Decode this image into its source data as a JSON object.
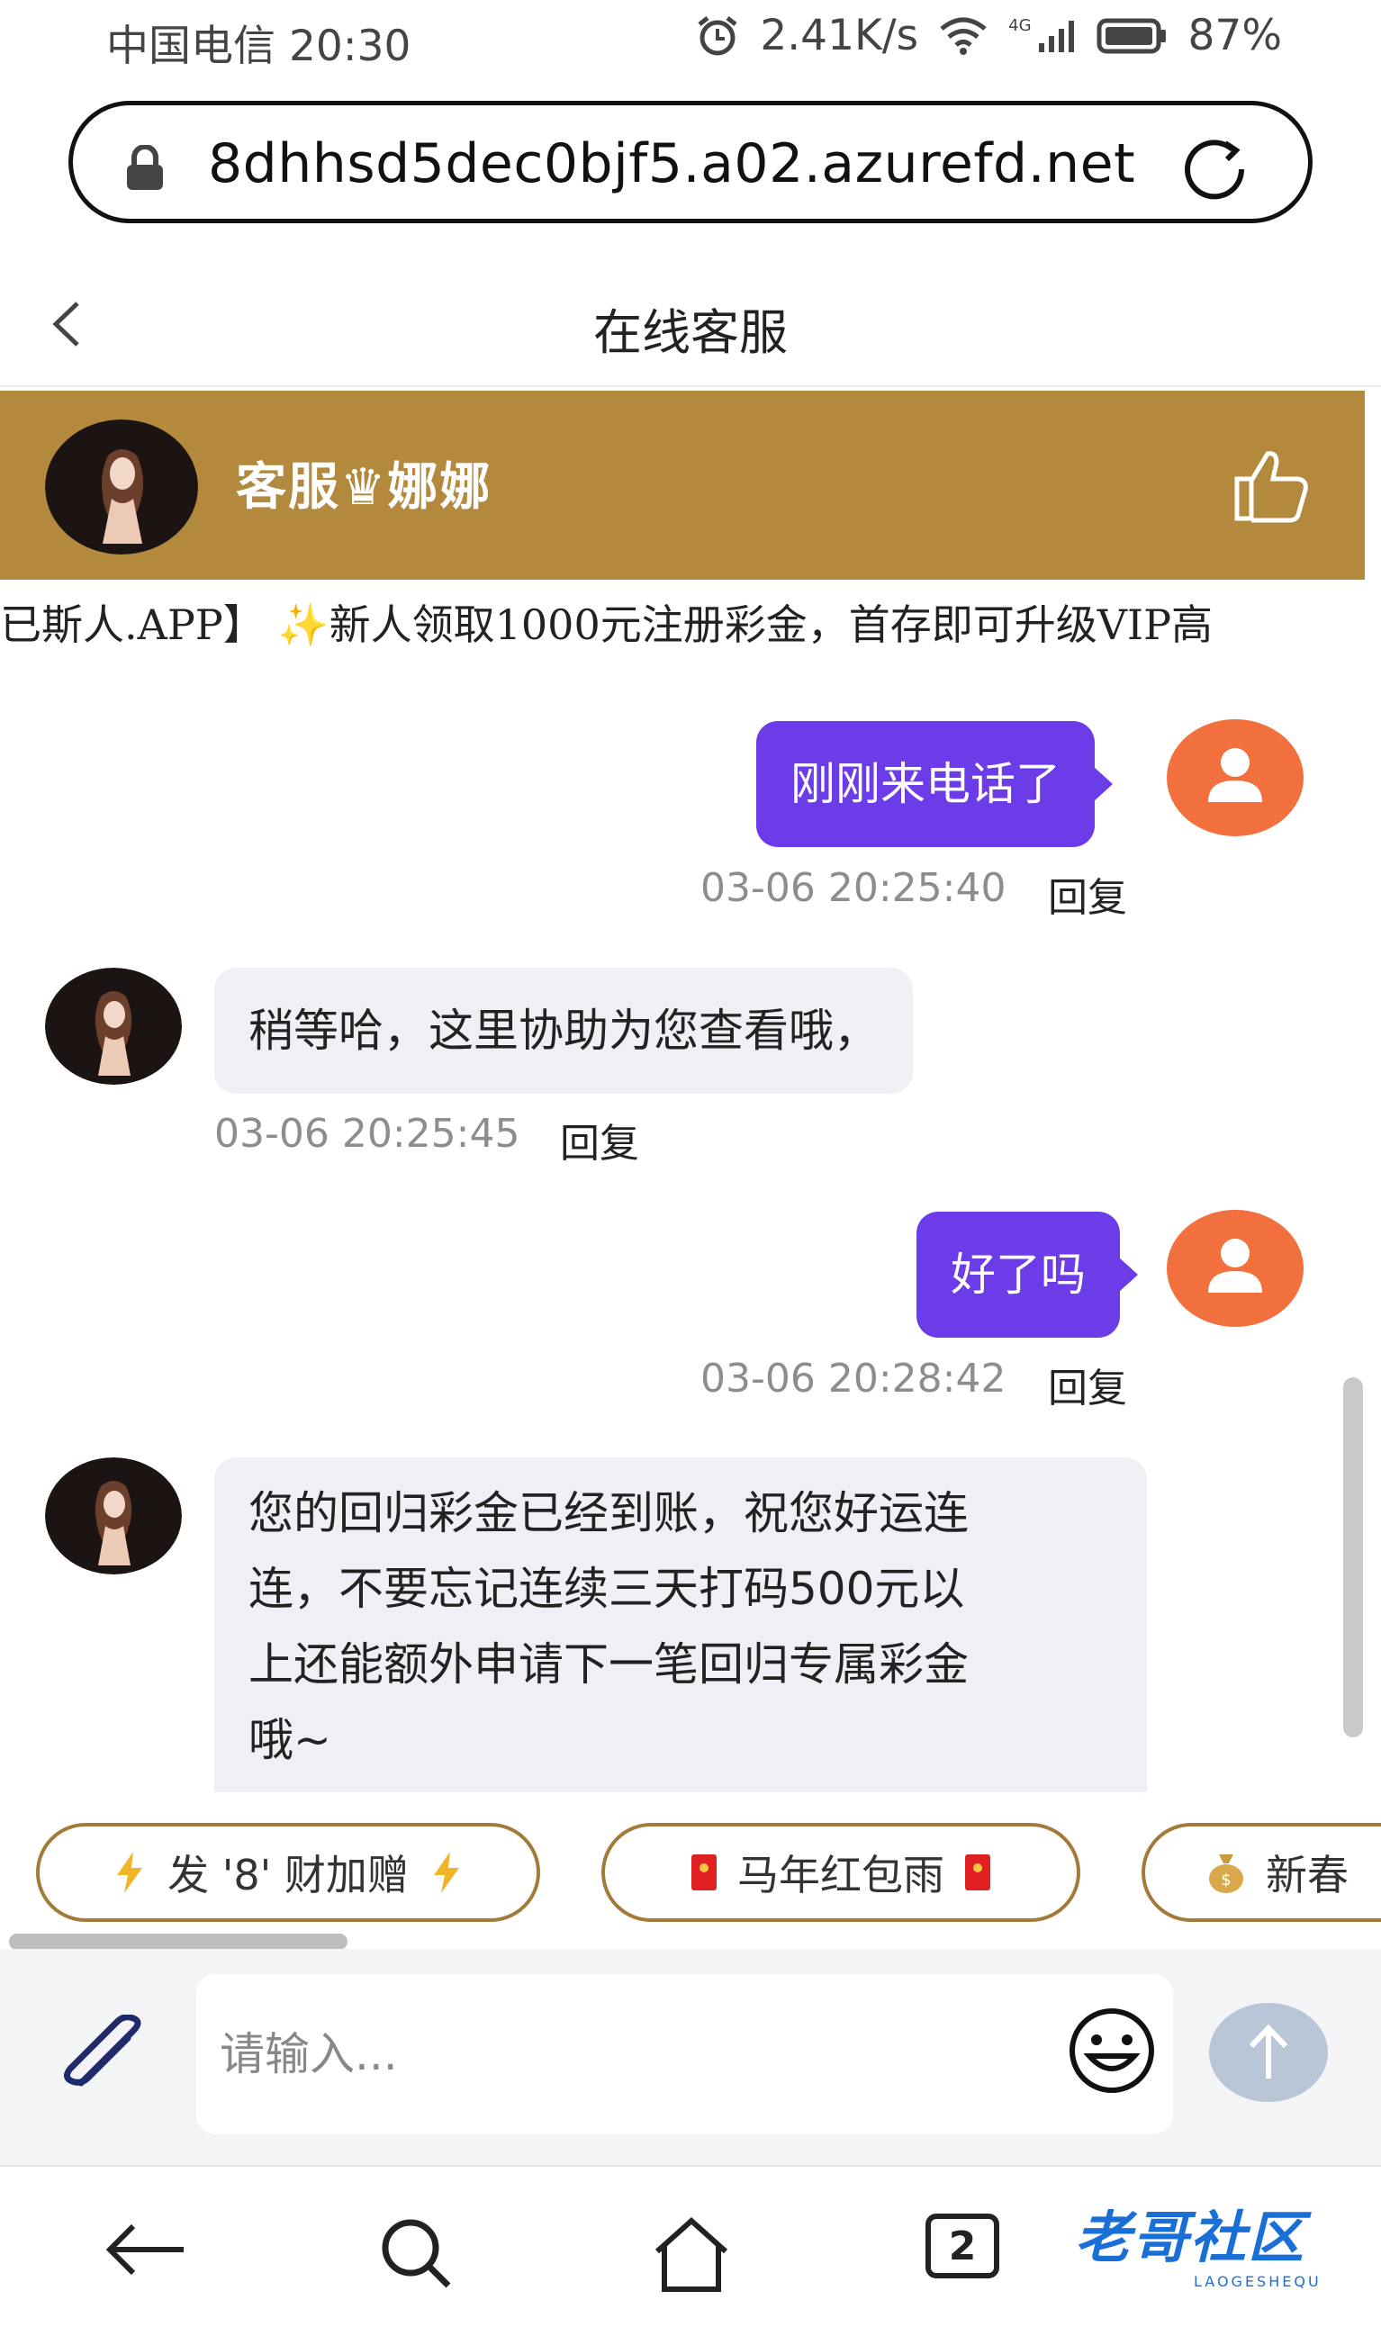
{
  "status_bar": {
    "carrier_time": "中国电信 20:30",
    "speed": "2.41K/s",
    "network": "4G",
    "battery": "87%"
  },
  "browser": {
    "url": "8dhhsd5dec0bjf5.a02.azurefd.net"
  },
  "header": {
    "title": "在线客服"
  },
  "agent": {
    "name": "客服♛娜娜"
  },
  "marquee": {
    "text": "已斯人.APP】 ✨新人领取1000元注册彩金，首存即可升级VIP高"
  },
  "messages": [
    {
      "side": "out",
      "text": "刚刚来电话了",
      "time": "03-06 20:25:40",
      "reply": "回复"
    },
    {
      "side": "in",
      "text": "稍等哈，这里协助为您查看哦，",
      "time": "03-06 20:25:45",
      "reply": "回复"
    },
    {
      "side": "out",
      "text": "好了吗",
      "time": "03-06 20:28:42",
      "reply": "回复"
    },
    {
      "side": "in",
      "lines": [
        "您的回归彩金已经到账，祝您好运连",
        "连，不要忘记连续三天打码500元以",
        "上还能额外申请下一笔回归专属彩金",
        "哦~"
      ]
    }
  ],
  "quick_actions": [
    {
      "label": "发 '8' 财加赠",
      "icon": "lightning-icon"
    },
    {
      "label": "马年红包雨",
      "icon": "red-envelope-icon"
    },
    {
      "label": "新春",
      "icon": "money-bag-icon"
    }
  ],
  "composer": {
    "placeholder": "请输入..."
  },
  "nav": {
    "tab_count": "2"
  },
  "watermark": {
    "text": "老哥社区",
    "sub": "LAOGESHEQU"
  },
  "colors": {
    "banner": "#b3893e",
    "outgoing_bubble": "#6c3ce8",
    "user_avatar": "#f2703e",
    "incoming_bubble": "#eef0f5"
  }
}
